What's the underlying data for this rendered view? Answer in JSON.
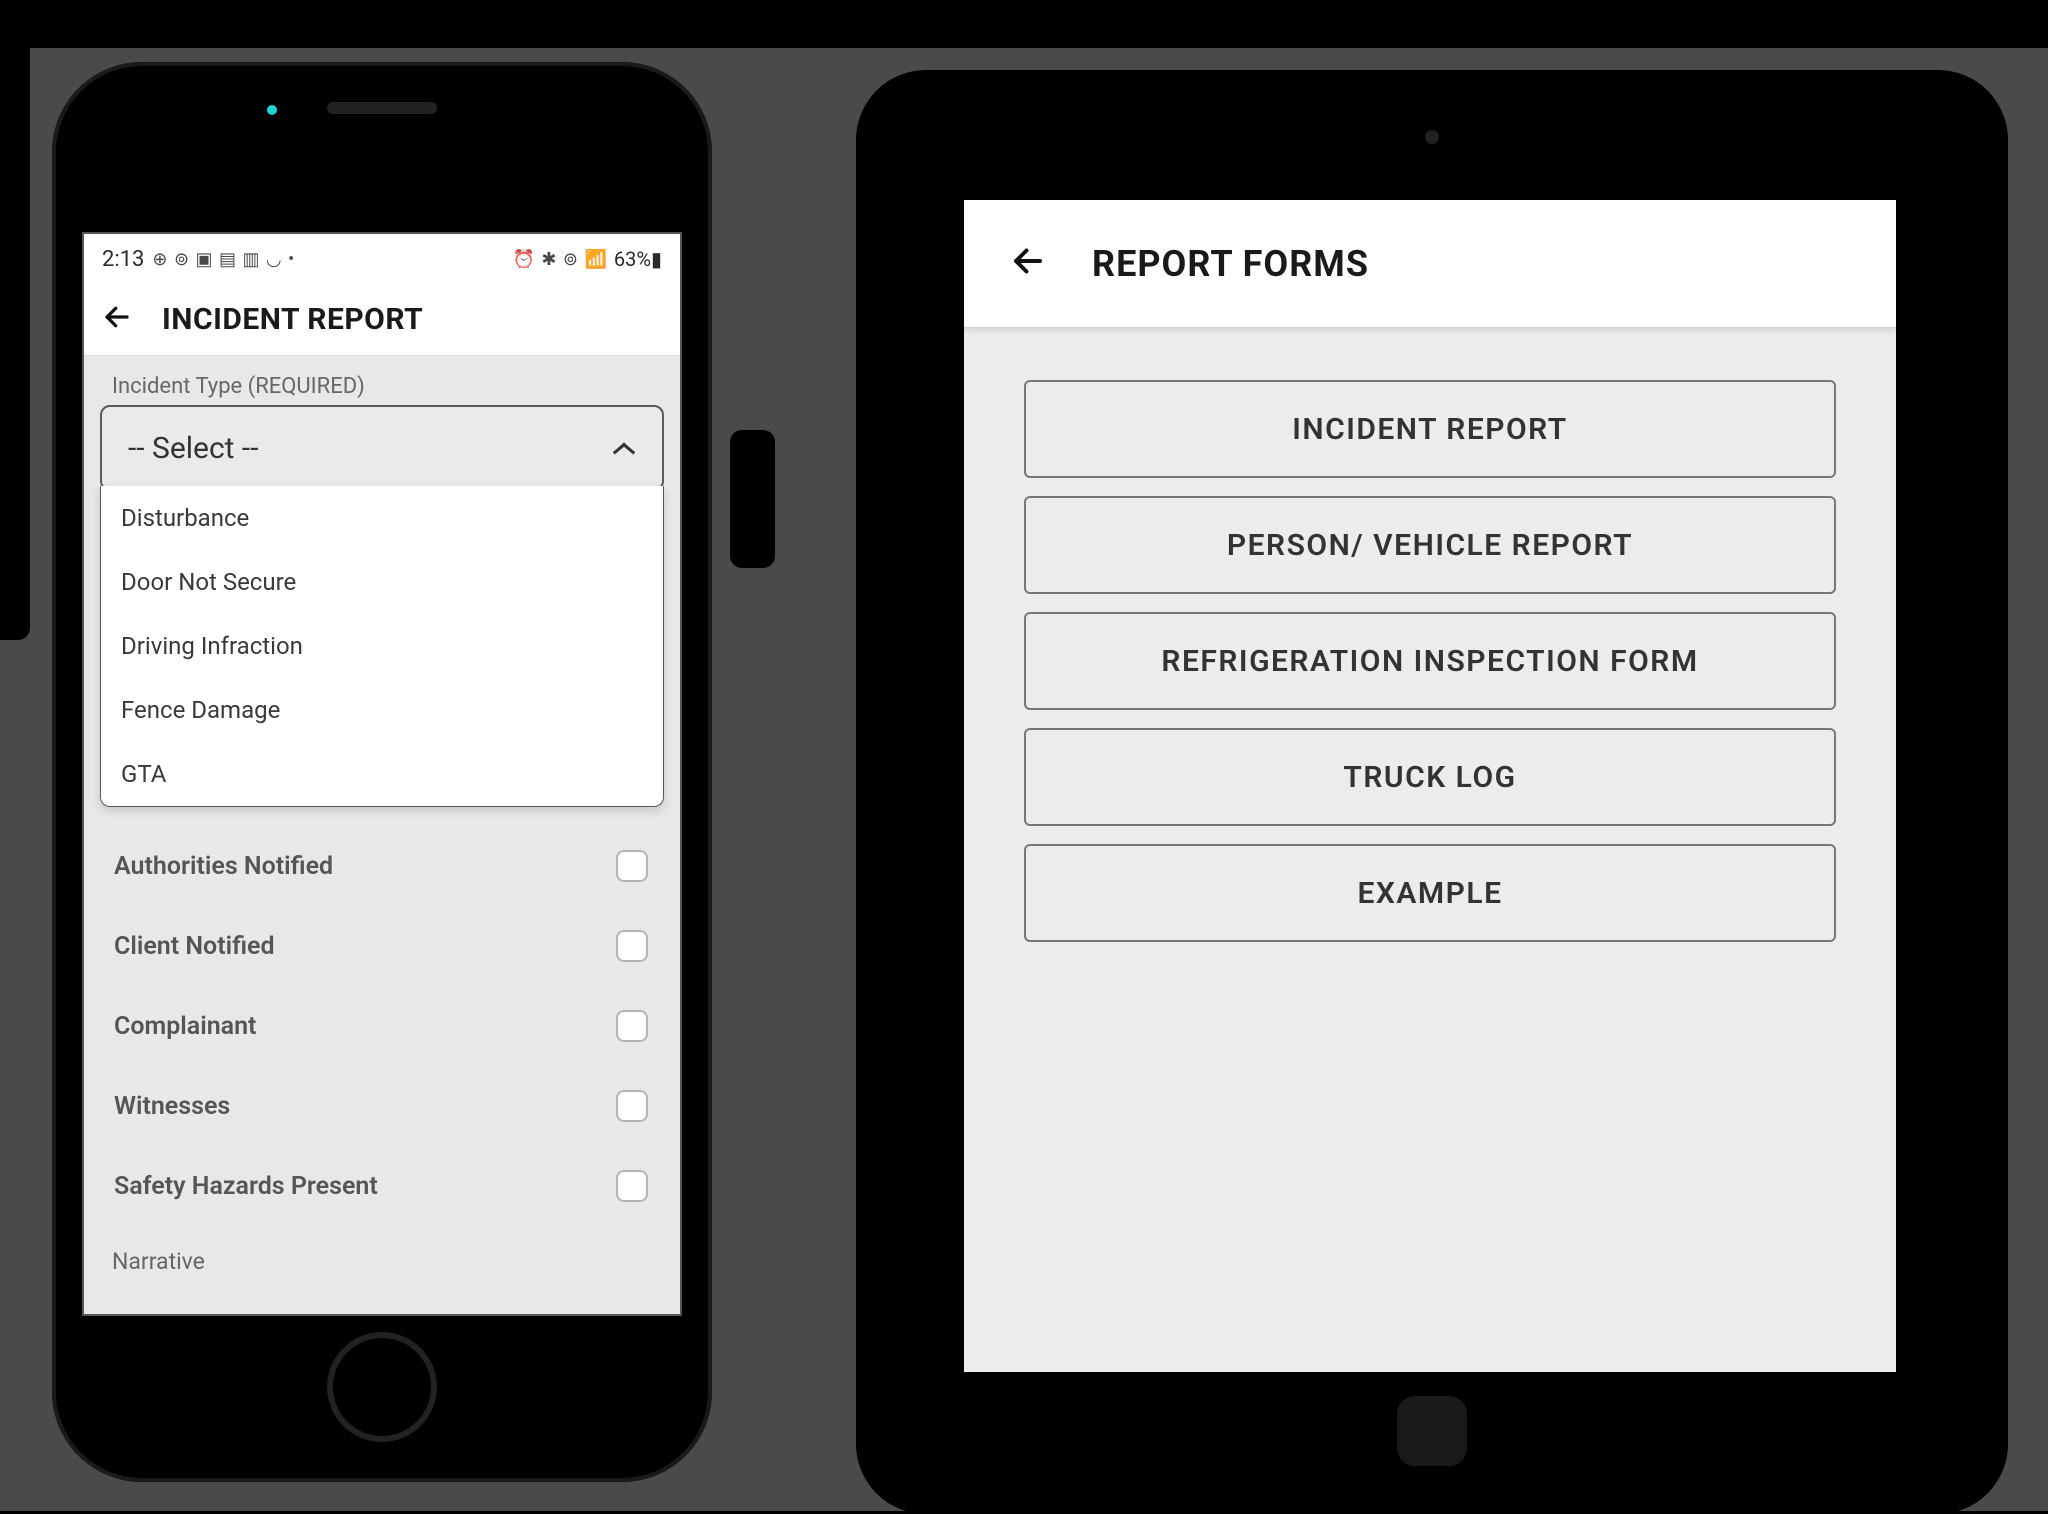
{
  "phone": {
    "status": {
      "time": "2:13",
      "left_icons": "⊕ ⊚ ▣ ▤ ▥ ◡ •",
      "right_icons": "⏰ ✱ ⊚ 📶  ",
      "battery": "63%▮"
    },
    "header": {
      "title": "INCIDENT REPORT"
    },
    "incident_type": {
      "label": "Incident Type (REQUIRED)",
      "placeholder": "-- Select --",
      "options": [
        "Disturbance",
        "Door Not Secure",
        "Driving Infraction",
        "Fence Damage",
        "GTA"
      ]
    },
    "checks": [
      "Authorities Notified",
      "Client Notified",
      "Complainant",
      "Witnesses",
      "Safety Hazards Present"
    ],
    "narrative_label": "Narrative"
  },
  "tablet": {
    "header": {
      "title": "REPORT FORMS"
    },
    "forms": [
      "INCIDENT REPORT",
      "PERSON/ VEHICLE REPORT",
      "REFRIGERATION INSPECTION FORM",
      "TRUCK LOG",
      "EXAMPLE"
    ]
  }
}
